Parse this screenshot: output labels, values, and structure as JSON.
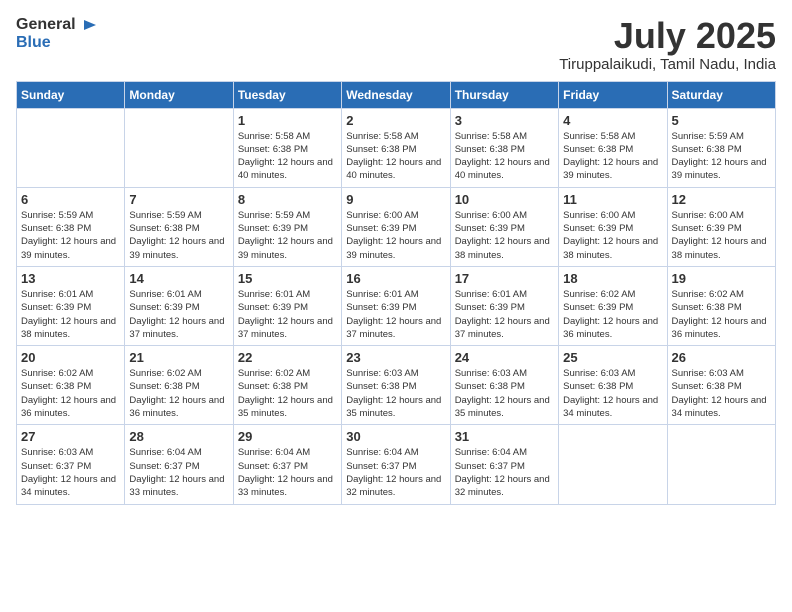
{
  "logo": {
    "general": "General",
    "blue": "Blue"
  },
  "header": {
    "month": "July 2025",
    "location": "Tiruppalaikudi, Tamil Nadu, India"
  },
  "weekdays": [
    "Sunday",
    "Monday",
    "Tuesday",
    "Wednesday",
    "Thursday",
    "Friday",
    "Saturday"
  ],
  "weeks": [
    [
      {
        "day": "",
        "detail": ""
      },
      {
        "day": "",
        "detail": ""
      },
      {
        "day": "1",
        "detail": "Sunrise: 5:58 AM\nSunset: 6:38 PM\nDaylight: 12 hours and 40 minutes."
      },
      {
        "day": "2",
        "detail": "Sunrise: 5:58 AM\nSunset: 6:38 PM\nDaylight: 12 hours and 40 minutes."
      },
      {
        "day": "3",
        "detail": "Sunrise: 5:58 AM\nSunset: 6:38 PM\nDaylight: 12 hours and 40 minutes."
      },
      {
        "day": "4",
        "detail": "Sunrise: 5:58 AM\nSunset: 6:38 PM\nDaylight: 12 hours and 39 minutes."
      },
      {
        "day": "5",
        "detail": "Sunrise: 5:59 AM\nSunset: 6:38 PM\nDaylight: 12 hours and 39 minutes."
      }
    ],
    [
      {
        "day": "6",
        "detail": "Sunrise: 5:59 AM\nSunset: 6:38 PM\nDaylight: 12 hours and 39 minutes."
      },
      {
        "day": "7",
        "detail": "Sunrise: 5:59 AM\nSunset: 6:38 PM\nDaylight: 12 hours and 39 minutes."
      },
      {
        "day": "8",
        "detail": "Sunrise: 5:59 AM\nSunset: 6:39 PM\nDaylight: 12 hours and 39 minutes."
      },
      {
        "day": "9",
        "detail": "Sunrise: 6:00 AM\nSunset: 6:39 PM\nDaylight: 12 hours and 39 minutes."
      },
      {
        "day": "10",
        "detail": "Sunrise: 6:00 AM\nSunset: 6:39 PM\nDaylight: 12 hours and 38 minutes."
      },
      {
        "day": "11",
        "detail": "Sunrise: 6:00 AM\nSunset: 6:39 PM\nDaylight: 12 hours and 38 minutes."
      },
      {
        "day": "12",
        "detail": "Sunrise: 6:00 AM\nSunset: 6:39 PM\nDaylight: 12 hours and 38 minutes."
      }
    ],
    [
      {
        "day": "13",
        "detail": "Sunrise: 6:01 AM\nSunset: 6:39 PM\nDaylight: 12 hours and 38 minutes."
      },
      {
        "day": "14",
        "detail": "Sunrise: 6:01 AM\nSunset: 6:39 PM\nDaylight: 12 hours and 37 minutes."
      },
      {
        "day": "15",
        "detail": "Sunrise: 6:01 AM\nSunset: 6:39 PM\nDaylight: 12 hours and 37 minutes."
      },
      {
        "day": "16",
        "detail": "Sunrise: 6:01 AM\nSunset: 6:39 PM\nDaylight: 12 hours and 37 minutes."
      },
      {
        "day": "17",
        "detail": "Sunrise: 6:01 AM\nSunset: 6:39 PM\nDaylight: 12 hours and 37 minutes."
      },
      {
        "day": "18",
        "detail": "Sunrise: 6:02 AM\nSunset: 6:39 PM\nDaylight: 12 hours and 36 minutes."
      },
      {
        "day": "19",
        "detail": "Sunrise: 6:02 AM\nSunset: 6:38 PM\nDaylight: 12 hours and 36 minutes."
      }
    ],
    [
      {
        "day": "20",
        "detail": "Sunrise: 6:02 AM\nSunset: 6:38 PM\nDaylight: 12 hours and 36 minutes."
      },
      {
        "day": "21",
        "detail": "Sunrise: 6:02 AM\nSunset: 6:38 PM\nDaylight: 12 hours and 36 minutes."
      },
      {
        "day": "22",
        "detail": "Sunrise: 6:02 AM\nSunset: 6:38 PM\nDaylight: 12 hours and 35 minutes."
      },
      {
        "day": "23",
        "detail": "Sunrise: 6:03 AM\nSunset: 6:38 PM\nDaylight: 12 hours and 35 minutes."
      },
      {
        "day": "24",
        "detail": "Sunrise: 6:03 AM\nSunset: 6:38 PM\nDaylight: 12 hours and 35 minutes."
      },
      {
        "day": "25",
        "detail": "Sunrise: 6:03 AM\nSunset: 6:38 PM\nDaylight: 12 hours and 34 minutes."
      },
      {
        "day": "26",
        "detail": "Sunrise: 6:03 AM\nSunset: 6:38 PM\nDaylight: 12 hours and 34 minutes."
      }
    ],
    [
      {
        "day": "27",
        "detail": "Sunrise: 6:03 AM\nSunset: 6:37 PM\nDaylight: 12 hours and 34 minutes."
      },
      {
        "day": "28",
        "detail": "Sunrise: 6:04 AM\nSunset: 6:37 PM\nDaylight: 12 hours and 33 minutes."
      },
      {
        "day": "29",
        "detail": "Sunrise: 6:04 AM\nSunset: 6:37 PM\nDaylight: 12 hours and 33 minutes."
      },
      {
        "day": "30",
        "detail": "Sunrise: 6:04 AM\nSunset: 6:37 PM\nDaylight: 12 hours and 32 minutes."
      },
      {
        "day": "31",
        "detail": "Sunrise: 6:04 AM\nSunset: 6:37 PM\nDaylight: 12 hours and 32 minutes."
      },
      {
        "day": "",
        "detail": ""
      },
      {
        "day": "",
        "detail": ""
      }
    ]
  ]
}
